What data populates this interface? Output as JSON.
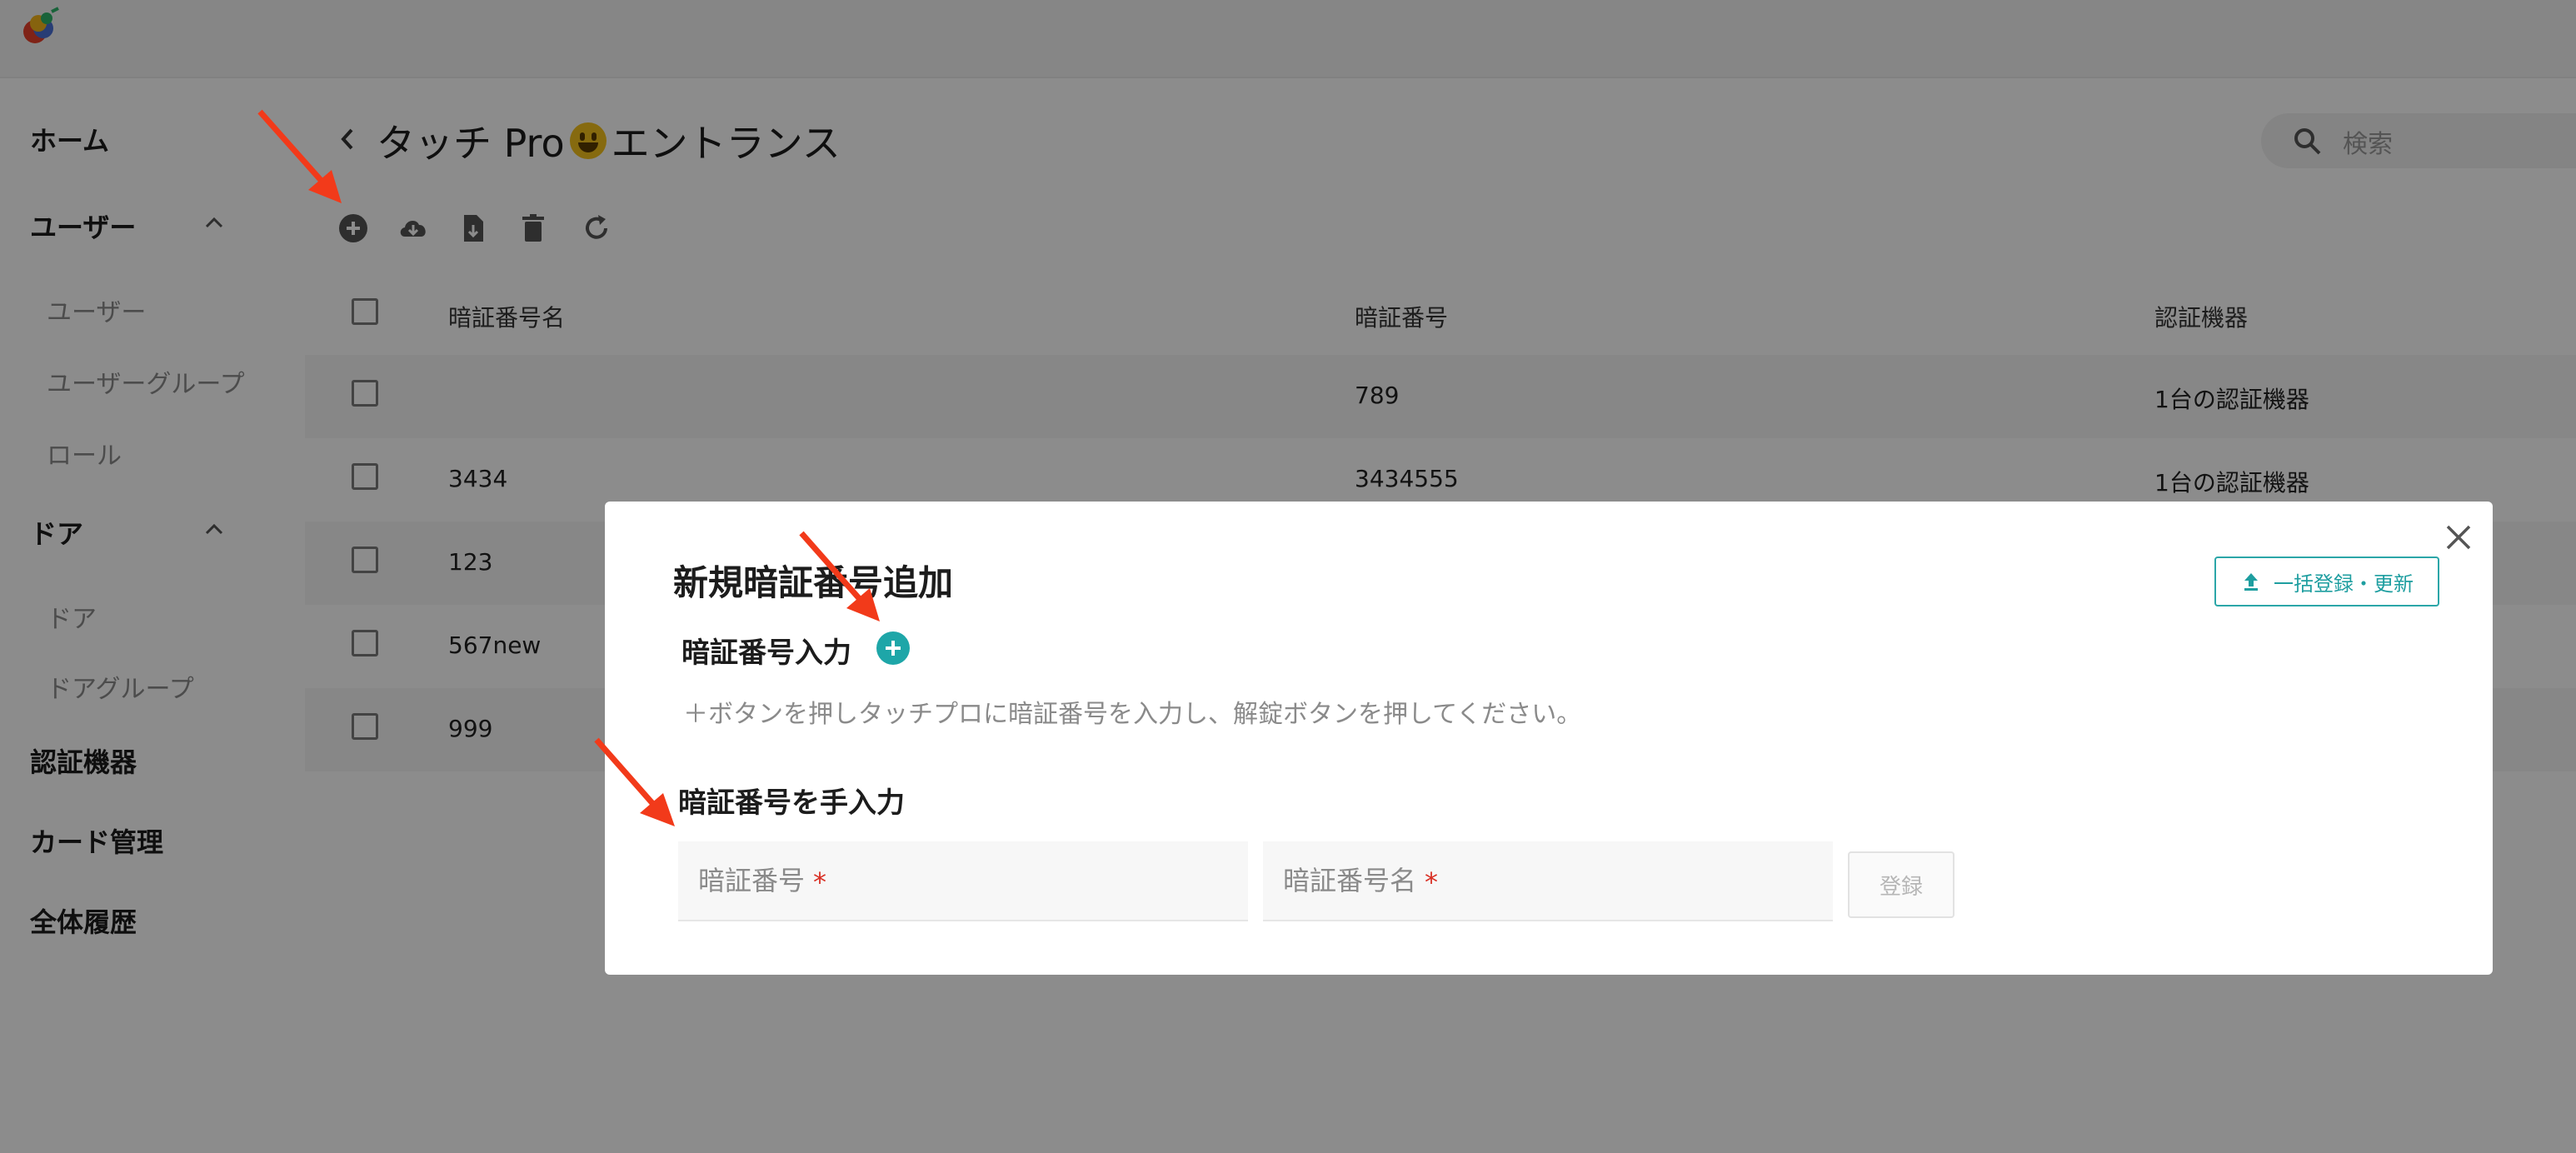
{
  "sidebar": {
    "items": [
      {
        "label": "ホーム"
      },
      {
        "label": "ユーザー"
      },
      {
        "label": "ユーザー"
      },
      {
        "label": "ユーザーグループ"
      },
      {
        "label": "ロール"
      },
      {
        "label": "ドア"
      },
      {
        "label": "ドア"
      },
      {
        "label": "ドアグループ"
      },
      {
        "label": "認証機器"
      },
      {
        "label": "カード管理"
      },
      {
        "label": "全体履歴"
      }
    ]
  },
  "header": {
    "title_pre": "タッチ Pro",
    "title_post": "エントランス",
    "search_placeholder": "検索"
  },
  "table": {
    "columns": [
      "暗証番号名",
      "暗証番号",
      "認証機器"
    ],
    "rows": [
      {
        "name": "",
        "pin": "789",
        "device": "1台の認証機器"
      },
      {
        "name": "3434",
        "pin": "3434555",
        "device": "1台の認証機器"
      },
      {
        "name": "123",
        "pin": "",
        "device": ""
      },
      {
        "name": "567new",
        "pin": "",
        "device": ""
      },
      {
        "name": "999",
        "pin": "",
        "device": ""
      }
    ]
  },
  "modal": {
    "title": "新規暗証番号追加",
    "bulk_label": "一括登録・更新",
    "input_section": "暗証番号入力",
    "hint": "＋ボタンを押しタッチプロに暗証番号を入力し、解錠ボタンを押してください。",
    "manual_section": "暗証番号を手入力",
    "pin_placeholder": "暗証番号",
    "pin_name_placeholder": "暗証番号名",
    "required_mark": "*",
    "register_label": "登録"
  },
  "colors": {
    "accent": "#1ea6a8",
    "annotation_arrow": "#f23a1a",
    "required": "#d93025"
  }
}
